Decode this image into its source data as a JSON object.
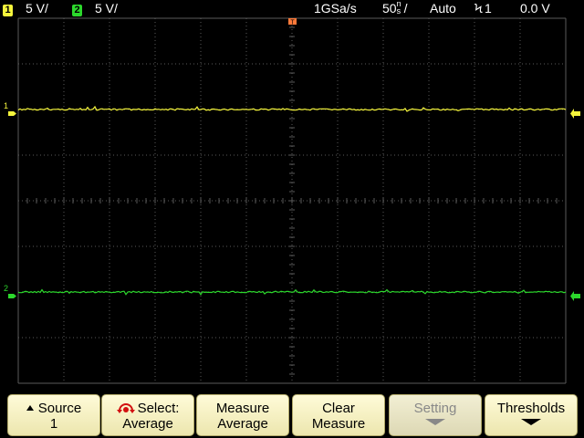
{
  "status_bar": {
    "ch1": {
      "badge": "1",
      "scale": "5 V/",
      "color": "#f5f53c"
    },
    "ch2": {
      "badge": "2",
      "scale": "5 V/",
      "color": "#2cd82c"
    },
    "sample_rate": "1GSa/s",
    "timebase_value": "50",
    "timebase_unit_top": "n",
    "timebase_unit_bottom": "s",
    "timebase_suffix": "/",
    "trigger_mode": "Auto",
    "trigger_symbol": "Ϟ",
    "trigger_source": "1",
    "trigger_level": "0.0 V"
  },
  "display": {
    "grid_color": "#5a5a5a",
    "ch1_marker": "1",
    "ch2_marker": "2",
    "trigger_marker": "T",
    "ch1_level_divisions": 2,
    "ch2_level_divisions": 6
  },
  "softkeys": [
    {
      "line1": "Source",
      "line2": "1",
      "icon": "up-triangle-icon",
      "enabled": true
    },
    {
      "line1": "Select:",
      "line2": "Average",
      "icon": "rotate-knob-icon",
      "enabled": true
    },
    {
      "line1": "Measure",
      "line2": "Average",
      "enabled": true
    },
    {
      "line1": "Clear",
      "line2": "Measure",
      "enabled": true
    },
    {
      "line1": "Setting",
      "line2": "",
      "icon": "down-arrow-icon",
      "enabled": false
    },
    {
      "line1": "Thresholds",
      "line2": "",
      "icon": "down-arrow-icon",
      "enabled": true
    }
  ]
}
